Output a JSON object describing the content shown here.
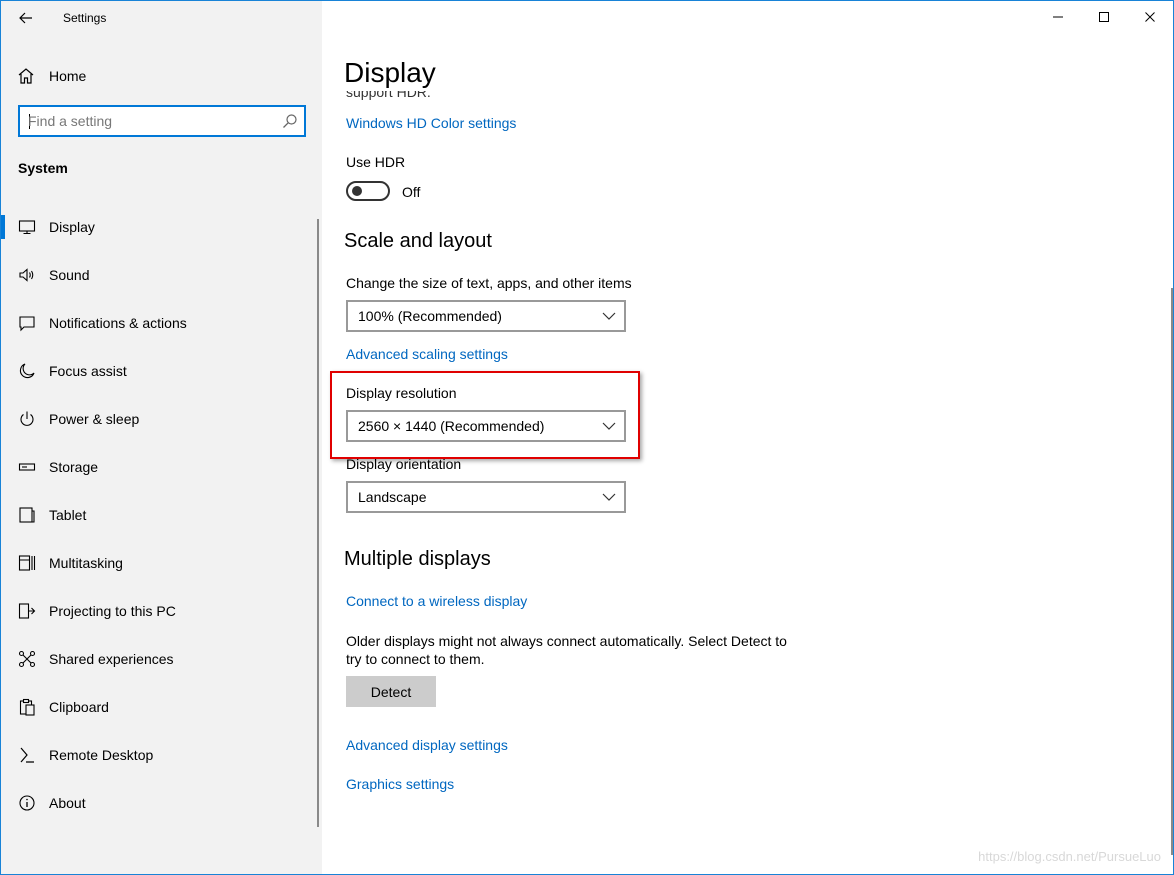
{
  "window": {
    "app_title": "Settings",
    "back_icon": "back-arrow-icon",
    "controls": [
      "minimize-icon",
      "maximize-icon",
      "close-icon"
    ]
  },
  "sidebar": {
    "home_label": "Home",
    "search": {
      "placeholder": "Find a setting",
      "value": ""
    },
    "group_title": "System",
    "items": [
      {
        "label": "Display",
        "icon": "monitor-icon",
        "active": true
      },
      {
        "label": "Sound",
        "icon": "speaker-icon",
        "active": false
      },
      {
        "label": "Notifications & actions",
        "icon": "message-icon",
        "active": false
      },
      {
        "label": "Focus assist",
        "icon": "moon-icon",
        "active": false
      },
      {
        "label": "Power & sleep",
        "icon": "power-icon",
        "active": false
      },
      {
        "label": "Storage",
        "icon": "storage-icon",
        "active": false
      },
      {
        "label": "Tablet",
        "icon": "tablet-icon",
        "active": false
      },
      {
        "label": "Multitasking",
        "icon": "multitasking-icon",
        "active": false
      },
      {
        "label": "Projecting to this PC",
        "icon": "projecting-icon",
        "active": false
      },
      {
        "label": "Shared experiences",
        "icon": "shared-icon",
        "active": false
      },
      {
        "label": "Clipboard",
        "icon": "clipboard-icon",
        "active": false
      },
      {
        "label": "Remote Desktop",
        "icon": "remote-desktop-icon",
        "active": false
      },
      {
        "label": "About",
        "icon": "info-icon",
        "active": false
      }
    ]
  },
  "main": {
    "page_title": "Display",
    "hdr_cut_text": "support HDR.",
    "hdr_color_link": "Windows HD Color settings",
    "use_hdr_label": "Use HDR",
    "use_hdr_state": "Off",
    "scale_section_title": "Scale and layout",
    "scale_label": "Change the size of text, apps, and other items",
    "scale_value": "100% (Recommended)",
    "advanced_scaling_link": "Advanced scaling settings",
    "resolution_label": "Display resolution",
    "resolution_value": "2560 × 1440 (Recommended)",
    "orientation_label": "Display orientation",
    "orientation_value": "Landscape",
    "multiple_section_title": "Multiple displays",
    "wireless_link": "Connect to a wireless display",
    "detect_text": "Older displays might not always connect automatically. Select Detect to try to connect to them.",
    "detect_button": "Detect",
    "advanced_display_link": "Advanced display settings",
    "graphics_link": "Graphics settings"
  },
  "watermark": "https://blog.csdn.net/PursueLuo",
  "colors": {
    "accent": "#0078d7",
    "link": "#0067c0",
    "highlight": "#e00000",
    "sidebar_bg": "#f2f2f2"
  }
}
